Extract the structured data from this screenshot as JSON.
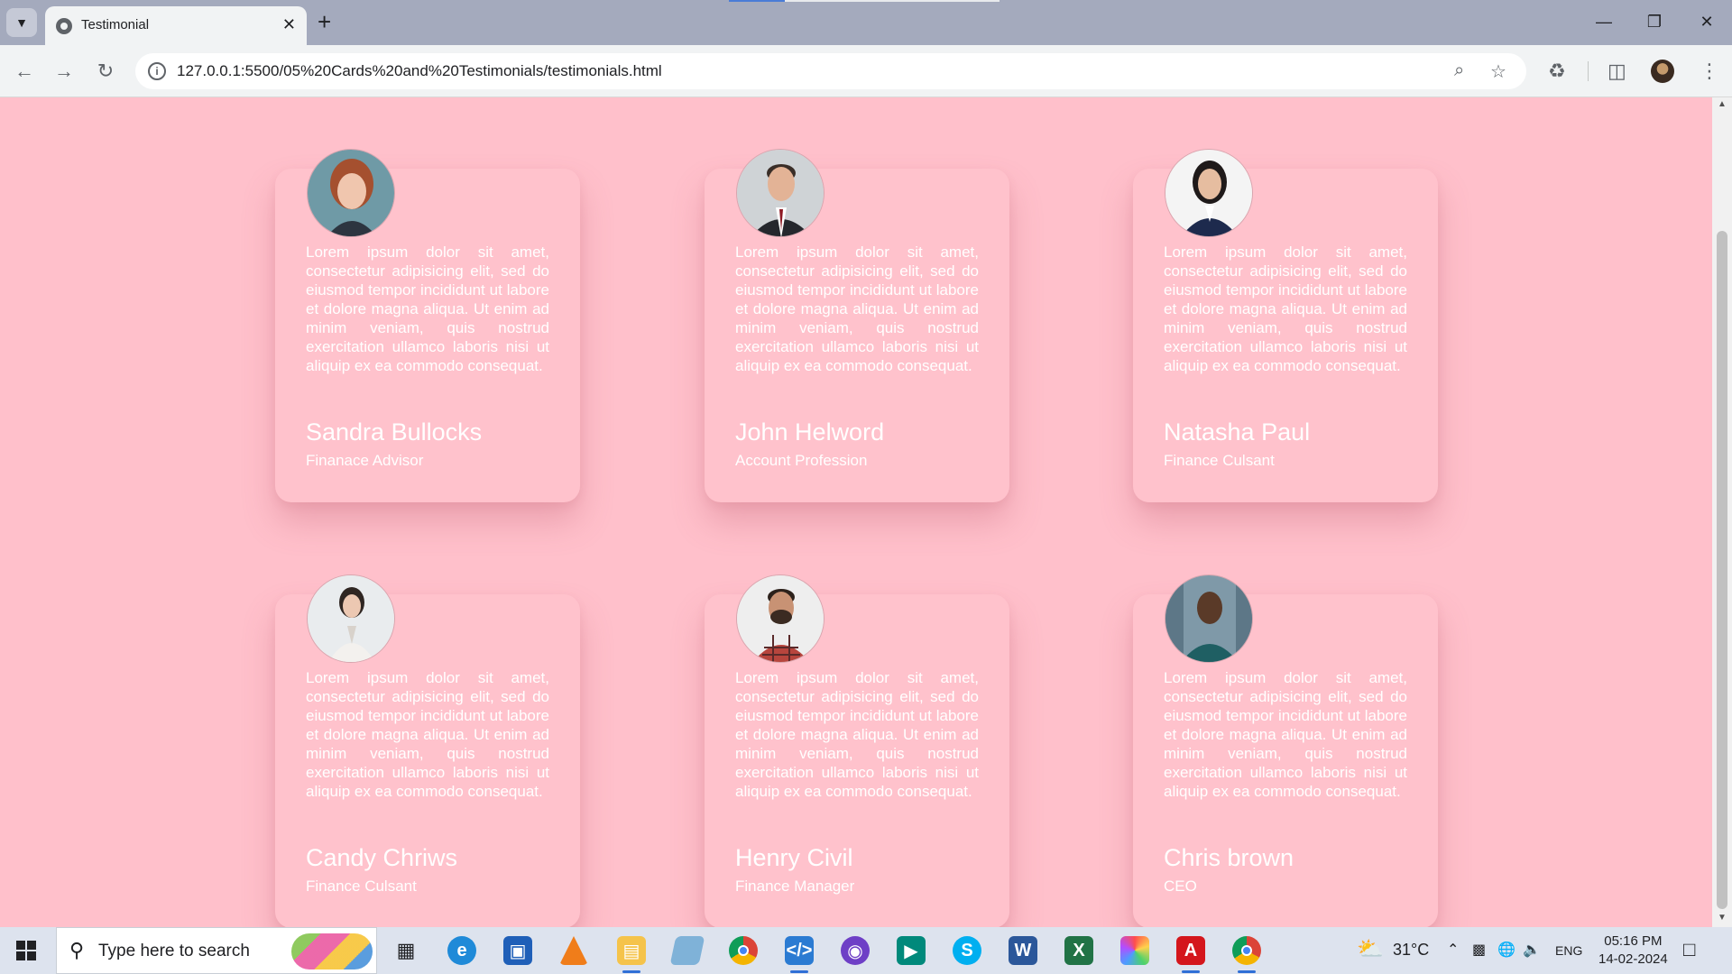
{
  "browser": {
    "tab_title": "Testimonial",
    "tab_close_glyph": "✕",
    "new_tab_glyph": "+",
    "url": "127.0.0.1:5500/05%20Cards%20and%20Testimonials/testimonials.html"
  },
  "cards": [
    {
      "name": "Sandra Bullocks",
      "role": "Finanace Advisor",
      "text": "Lorem ipsum dolor sit amet, consectetur adipisicing elit, sed do eiusmod tempor incididunt ut labore et dolore magna aliqua. Ut enim ad minim veniam, quis nostrud exercitation ullamco laboris nisi ut aliquip ex ea commodo consequat."
    },
    {
      "name": "John Helword",
      "role": "Account Profession",
      "text": "Lorem ipsum dolor sit amet, consectetur adipisicing elit, sed do eiusmod tempor incididunt ut labore et dolore magna aliqua. Ut enim ad minim veniam, quis nostrud exercitation ullamco laboris nisi ut aliquip ex ea commodo consequat."
    },
    {
      "name": "Natasha Paul",
      "role": "Finance Culsant",
      "text": "Lorem ipsum dolor sit amet, consectetur adipisicing elit, sed do eiusmod tempor incididunt ut labore et dolore magna aliqua. Ut enim ad minim veniam, quis nostrud exercitation ullamco laboris nisi ut aliquip ex ea commodo consequat."
    },
    {
      "name": "Candy Chriws",
      "role": "Finance Culsant",
      "text": "Lorem ipsum dolor sit amet, consectetur adipisicing elit, sed do eiusmod tempor incididunt ut labore et dolore magna aliqua. Ut enim ad minim veniam, quis nostrud exercitation ullamco laboris nisi ut aliquip ex ea commodo consequat."
    },
    {
      "name": "Henry Civil",
      "role": "Finance Manager",
      "text": "Lorem ipsum dolor sit amet, consectetur adipisicing elit, sed do eiusmod tempor incididunt ut labore et dolore magna aliqua. Ut enim ad minim veniam, quis nostrud exercitation ullamco laboris nisi ut aliquip ex ea commodo consequat."
    },
    {
      "name": "Chris brown",
      "role": "CEO",
      "text": "Lorem ipsum dolor sit amet, consectetur adipisicing elit, sed do eiusmod tempor incididunt ut labore et dolore magna aliqua. Ut enim ad minim veniam, quis nostrud exercitation ullamco laboris nisi ut aliquip ex ea commodo consequat."
    }
  ],
  "taskbar": {
    "search_placeholder": "Type here to search",
    "weather": "31°C",
    "language": "ENG",
    "time": "05:16 PM",
    "date": "14-02-2024"
  },
  "colors": {
    "page_background": "#ffc0cb",
    "card_background": "#ffc2cc",
    "card_text": "#ffffff",
    "tabstrip": "#a4aabd"
  },
  "icons": {
    "back": "arrow-left-icon",
    "forward": "arrow-right-icon",
    "reload": "reload-icon",
    "site_info": "info-icon",
    "zoom": "zoom-icon",
    "bookmark": "star-icon",
    "extensions": "puzzle-icon",
    "side_panel": "side-panel-icon",
    "menu": "kebab-menu-icon"
  }
}
